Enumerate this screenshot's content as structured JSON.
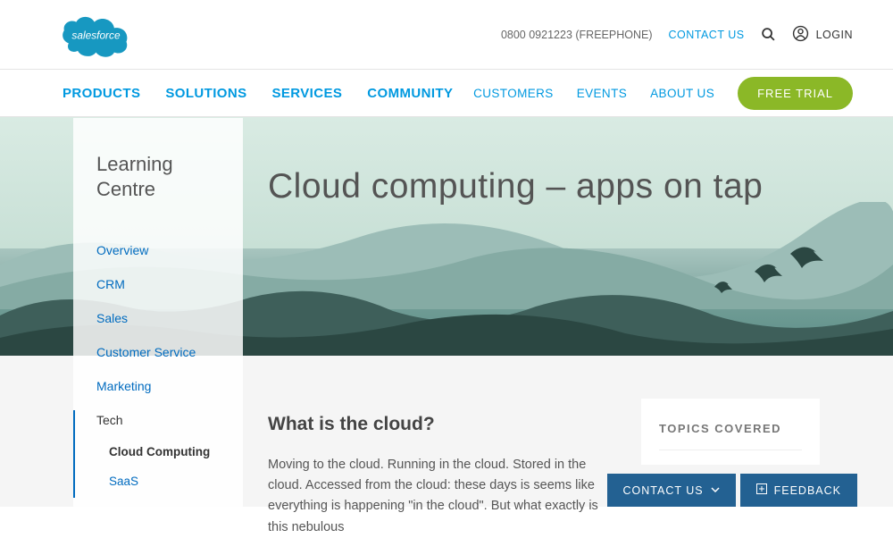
{
  "brand": {
    "name": "salesforce"
  },
  "utility": {
    "phone": "0800 0921223 (FREEPHONE)",
    "contact": "CONTACT US",
    "login": "LOGIN"
  },
  "nav": {
    "primary": [
      "PRODUCTS",
      "SOLUTIONS",
      "SERVICES",
      "COMMUNITY"
    ],
    "secondary": [
      "CUSTOMERS",
      "EVENTS",
      "ABOUT US"
    ],
    "cta": "FREE TRIAL"
  },
  "hero": {
    "title": "Cloud computing – apps on tap"
  },
  "sidebar": {
    "title": "Learning Centre",
    "items": [
      {
        "label": "Overview"
      },
      {
        "label": "CRM"
      },
      {
        "label": "Sales"
      },
      {
        "label": "Customer Service"
      },
      {
        "label": "Marketing"
      },
      {
        "label": "Tech",
        "active": true,
        "children": [
          {
            "label": "Cloud Computing",
            "current": true
          },
          {
            "label": "SaaS"
          }
        ]
      }
    ]
  },
  "article": {
    "heading": "What is the cloud?",
    "body": "Moving to the cloud. Running in the cloud. Stored in the cloud. Accessed from the cloud: these days is seems like everything is happening \"in the cloud\". But what exactly is this nebulous"
  },
  "topics": {
    "title": "TOPICS COVERED"
  },
  "bottom": {
    "contact": "CONTACT US",
    "feedback": "FEEDBACK"
  }
}
